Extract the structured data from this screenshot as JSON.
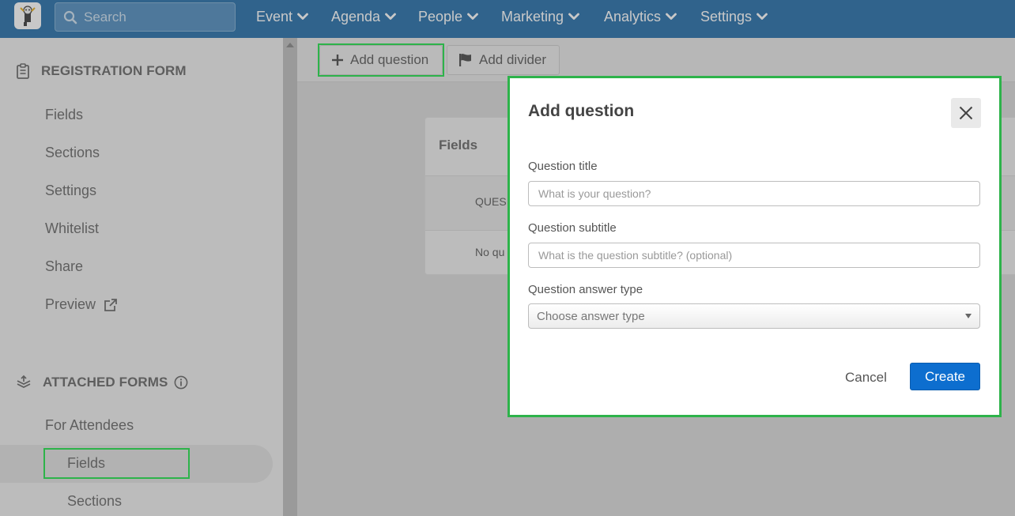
{
  "topbar": {
    "search_placeholder": "Search",
    "nav": [
      {
        "label": "Event"
      },
      {
        "label": "Agenda"
      },
      {
        "label": "People"
      },
      {
        "label": "Marketing"
      },
      {
        "label": "Analytics"
      },
      {
        "label": "Settings"
      }
    ]
  },
  "sidebar": {
    "registration_heading": "REGISTRATION FORM",
    "registration_items": [
      "Fields",
      "Sections",
      "Settings",
      "Whitelist",
      "Share",
      "Preview"
    ],
    "attached_heading": "ATTACHED FORMS",
    "attached_items": [
      "For Attendees",
      "Fields",
      "Sections"
    ]
  },
  "toolbar": {
    "add_question": "Add question",
    "add_divider": "Add divider"
  },
  "card": {
    "title": "Fields",
    "column": "QUES",
    "empty": "No qu"
  },
  "modal": {
    "title": "Add question",
    "question_title_label": "Question title",
    "question_title_placeholder": "What is your question?",
    "question_subtitle_label": "Question subtitle",
    "question_subtitle_placeholder": "What is the question subtitle? (optional)",
    "answer_type_label": "Question answer type",
    "answer_type_selected": "Choose answer type",
    "cancel": "Cancel",
    "create": "Create"
  },
  "colors": {
    "nav_bg": "#0b5d9f",
    "primary_button": "#0d6ecf",
    "highlight": "#2db34a"
  }
}
